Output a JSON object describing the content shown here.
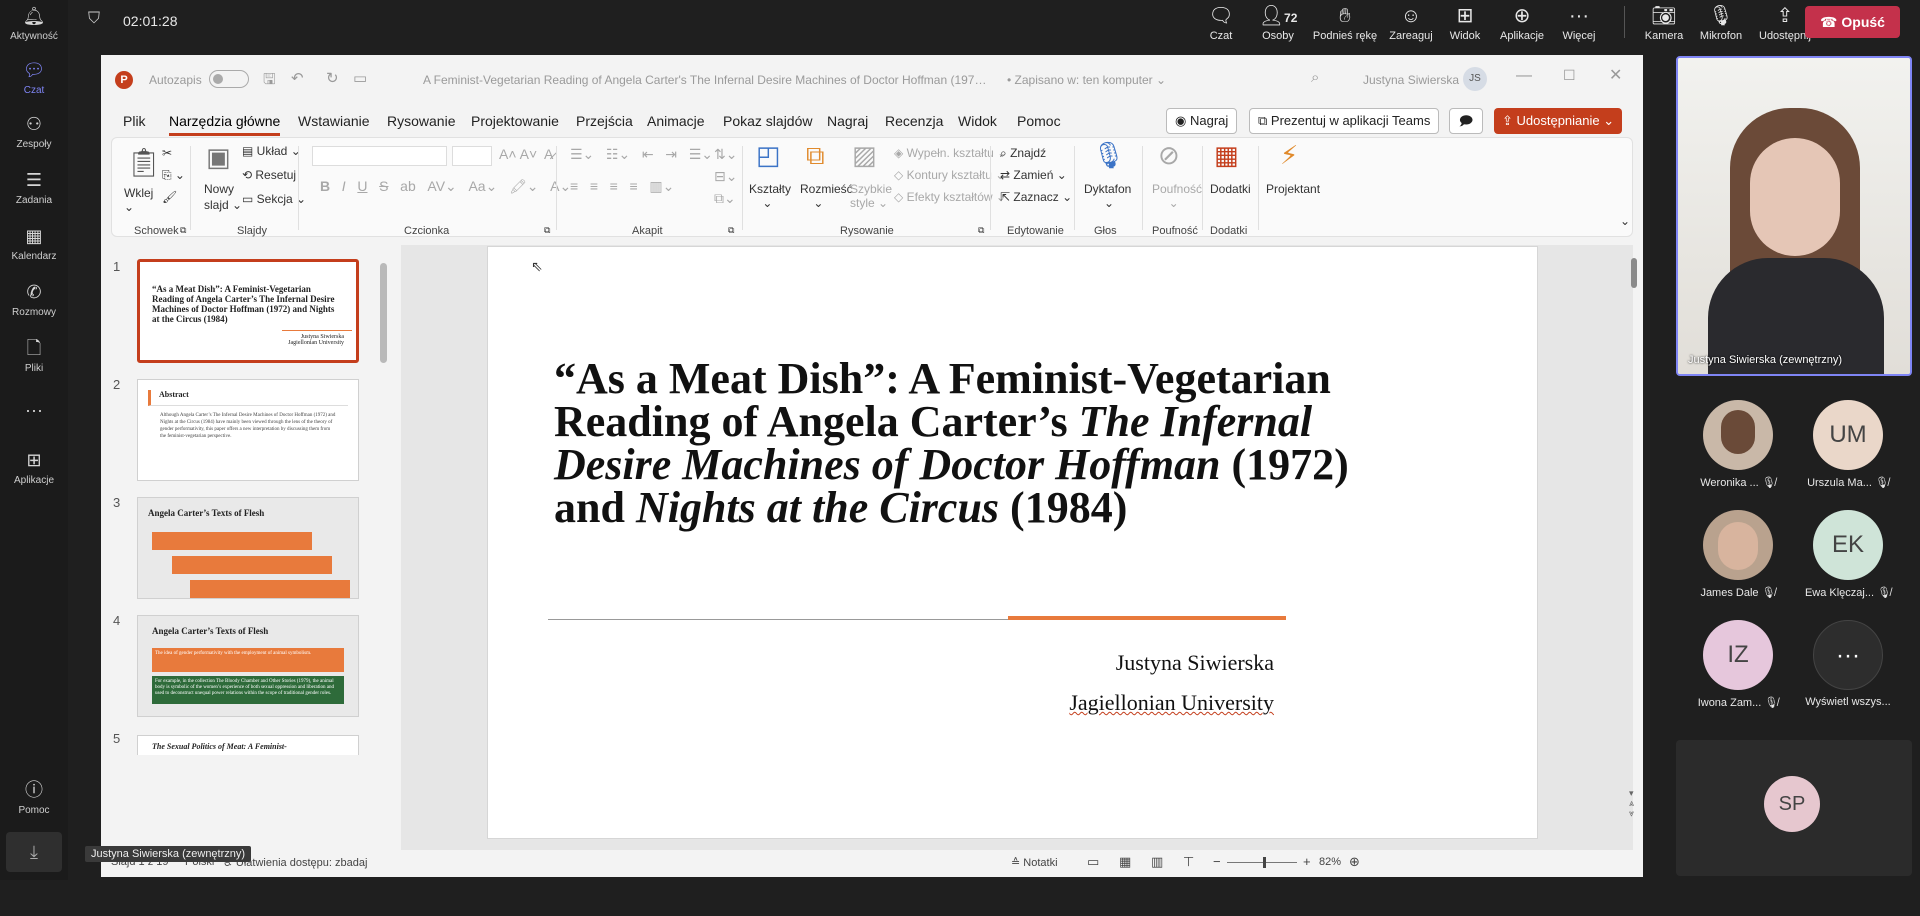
{
  "teams": {
    "timer": "02:01:28",
    "rail": [
      {
        "label": "Aktywność",
        "icon": "bell-icon"
      },
      {
        "label": "Czat",
        "icon": "chat-icon",
        "active": true
      },
      {
        "label": "Zespoły",
        "icon": "teams-icon"
      },
      {
        "label": "Zadania",
        "icon": "tasks-icon"
      },
      {
        "label": "Kalendarz",
        "icon": "calendar-icon"
      },
      {
        "label": "Rozmowy",
        "icon": "phone-icon"
      },
      {
        "label": "Pliki",
        "icon": "file-icon"
      },
      {
        "label": "Aplikacje",
        "icon": "apps-icon"
      },
      {
        "label": "Pomoc",
        "icon": "help-icon"
      }
    ],
    "toolbar": {
      "chat": "Czat",
      "people": "Osoby",
      "people_count": "72",
      "raise": "Podnieś rękę",
      "react": "Zareaguj",
      "view": "Widok",
      "apps": "Aplikacje",
      "more": "Więcej",
      "camera": "Kamera",
      "mic": "Mikrofon",
      "share": "Udostępnij",
      "leave": "Opuść"
    },
    "speaker_name": "Justyna Siwierska (zewnętrzny)",
    "presenter_caption": "Justyna Siwierska (zewnętrzny)",
    "participants": [
      {
        "name": "Weronika ...",
        "initials": ""
      },
      {
        "name": "Urszula Ma...",
        "initials": "UM",
        "color": "#ead7c9"
      },
      {
        "name": "James Dale",
        "initials": ""
      },
      {
        "name": "Ewa Klęczaj...",
        "initials": "EK",
        "color": "#cfe4d8"
      },
      {
        "name": "Iwona Zam...",
        "initials": "IZ",
        "color": "#e6c7dc"
      },
      {
        "name": "Wyświetl wszys...",
        "initials": "···",
        "color": "#2d2d2d"
      }
    ],
    "bottom_tile_initials": "SP"
  },
  "ppt": {
    "autosave": "Autozapis",
    "doc_title": "A Feminist-Vegetarian Reading of Angela Carter's The Infernal Desire Machines of Doctor Hoffman (1972) and Nights at the...",
    "save_status": "Zapisano w: ten komputer",
    "user": "Justyna Siwierska",
    "user_initials": "JS",
    "menus": [
      "Plik",
      "Narzędzia główne",
      "Wstawianie",
      "Rysowanie",
      "Projektowanie",
      "Przejścia",
      "Animacje",
      "Pokaz slajdów",
      "Nagraj",
      "Recenzja",
      "Widok",
      "Pomoc"
    ],
    "record_btn": "Nagraj",
    "teams_btn": "Prezentuj w aplikacji Teams",
    "share_btn": "Udostępnianie",
    "ribbon": {
      "paste": "Wklej",
      "clipboard": "Schowek",
      "new_slide_1": "Nowy",
      "new_slide_2": "slajd",
      "layout": "Układ",
      "reset": "Resetuj",
      "section": "Sekcja",
      "slides": "Slajdy",
      "font": "Czcionka",
      "paragraph": "Akapit",
      "shapes": "Kształty",
      "arrange": "Rozmieść",
      "quick_styles_1": "Szybkie",
      "quick_styles_2": "style",
      "fill": "Wypełn. kształtu",
      "outline": "Kontury kształtu",
      "effects": "Efekty kształtów",
      "drawing": "Rysowanie",
      "find": "Znajdź",
      "replace": "Zamień",
      "select": "Zaznacz",
      "editing": "Edytowanie",
      "dictate": "Dyktafon",
      "voice": "Głos",
      "sensitivity": "Poufność",
      "sensitivity_group": "Poufność",
      "addins": "Dodatki",
      "addins_group": "Dodatki",
      "designer": "Projektant"
    },
    "thumbnails": [
      {
        "num": "1",
        "title": "“As a Meat Dish”: A Feminist-Vegetarian Reading of Angela Carter’s The Infernal Desire Machines of Doctor Hoffman (1972) and Nights at the Circus (1984)",
        "author": "Justyna Siwierska",
        "affiliation": "Jagiellonian University"
      },
      {
        "num": "2",
        "title": "Abstract",
        "body": "Although Angela Carter’s The Infernal Desire Machines of Doctor Hoffman (1972) and Nights at the Circus (1984) have mainly been viewed through the lens of the theory of gender performativity, this paper offers a new interpretation by discussing them from the feminist-vegetarian perspective."
      },
      {
        "num": "3",
        "title": "Angela Carter’s Texts of Flesh"
      },
      {
        "num": "4",
        "title": "Angela Carter’s Texts of Flesh",
        "box1": "The idea of gender performativity with the employment of animal symbolism.",
        "box2": "For example, in the collection The Bloody Chamber and Other Stories (1979), the animal body is symbolic of the women’s experience of both sexual oppression and liberation and used to deconstruct unequal power relations within the scope of traditional gender roles."
      },
      {
        "num": "5",
        "title": "The Sexual Politics of Meat: A Feminist-"
      }
    ],
    "slide": {
      "title_l1": "“As a Meat Dish”: A Feminist-Vegetarian",
      "title_l2a": "Reading of Angela Carter’s ",
      "title_l2b": "The Infernal",
      "title_l3a": "Desire Machines of Doctor Hoffman",
      "title_l3b": " (1972)",
      "title_l4a": "and ",
      "title_l4b": "Nights at the Circus",
      "title_l4c": " (1984)",
      "author": "Justyna Siwierska",
      "affiliation": "Jagiellonian University"
    },
    "status": {
      "slide_info": "Slajd 1 z 19",
      "lang": "Polski",
      "accessibility": "Ułatwienia dostępu: zbadaj",
      "notes": "Notatki",
      "zoom": "82%"
    },
    "accent": "#c43e1c",
    "slide_accent": "#e87a3c"
  }
}
